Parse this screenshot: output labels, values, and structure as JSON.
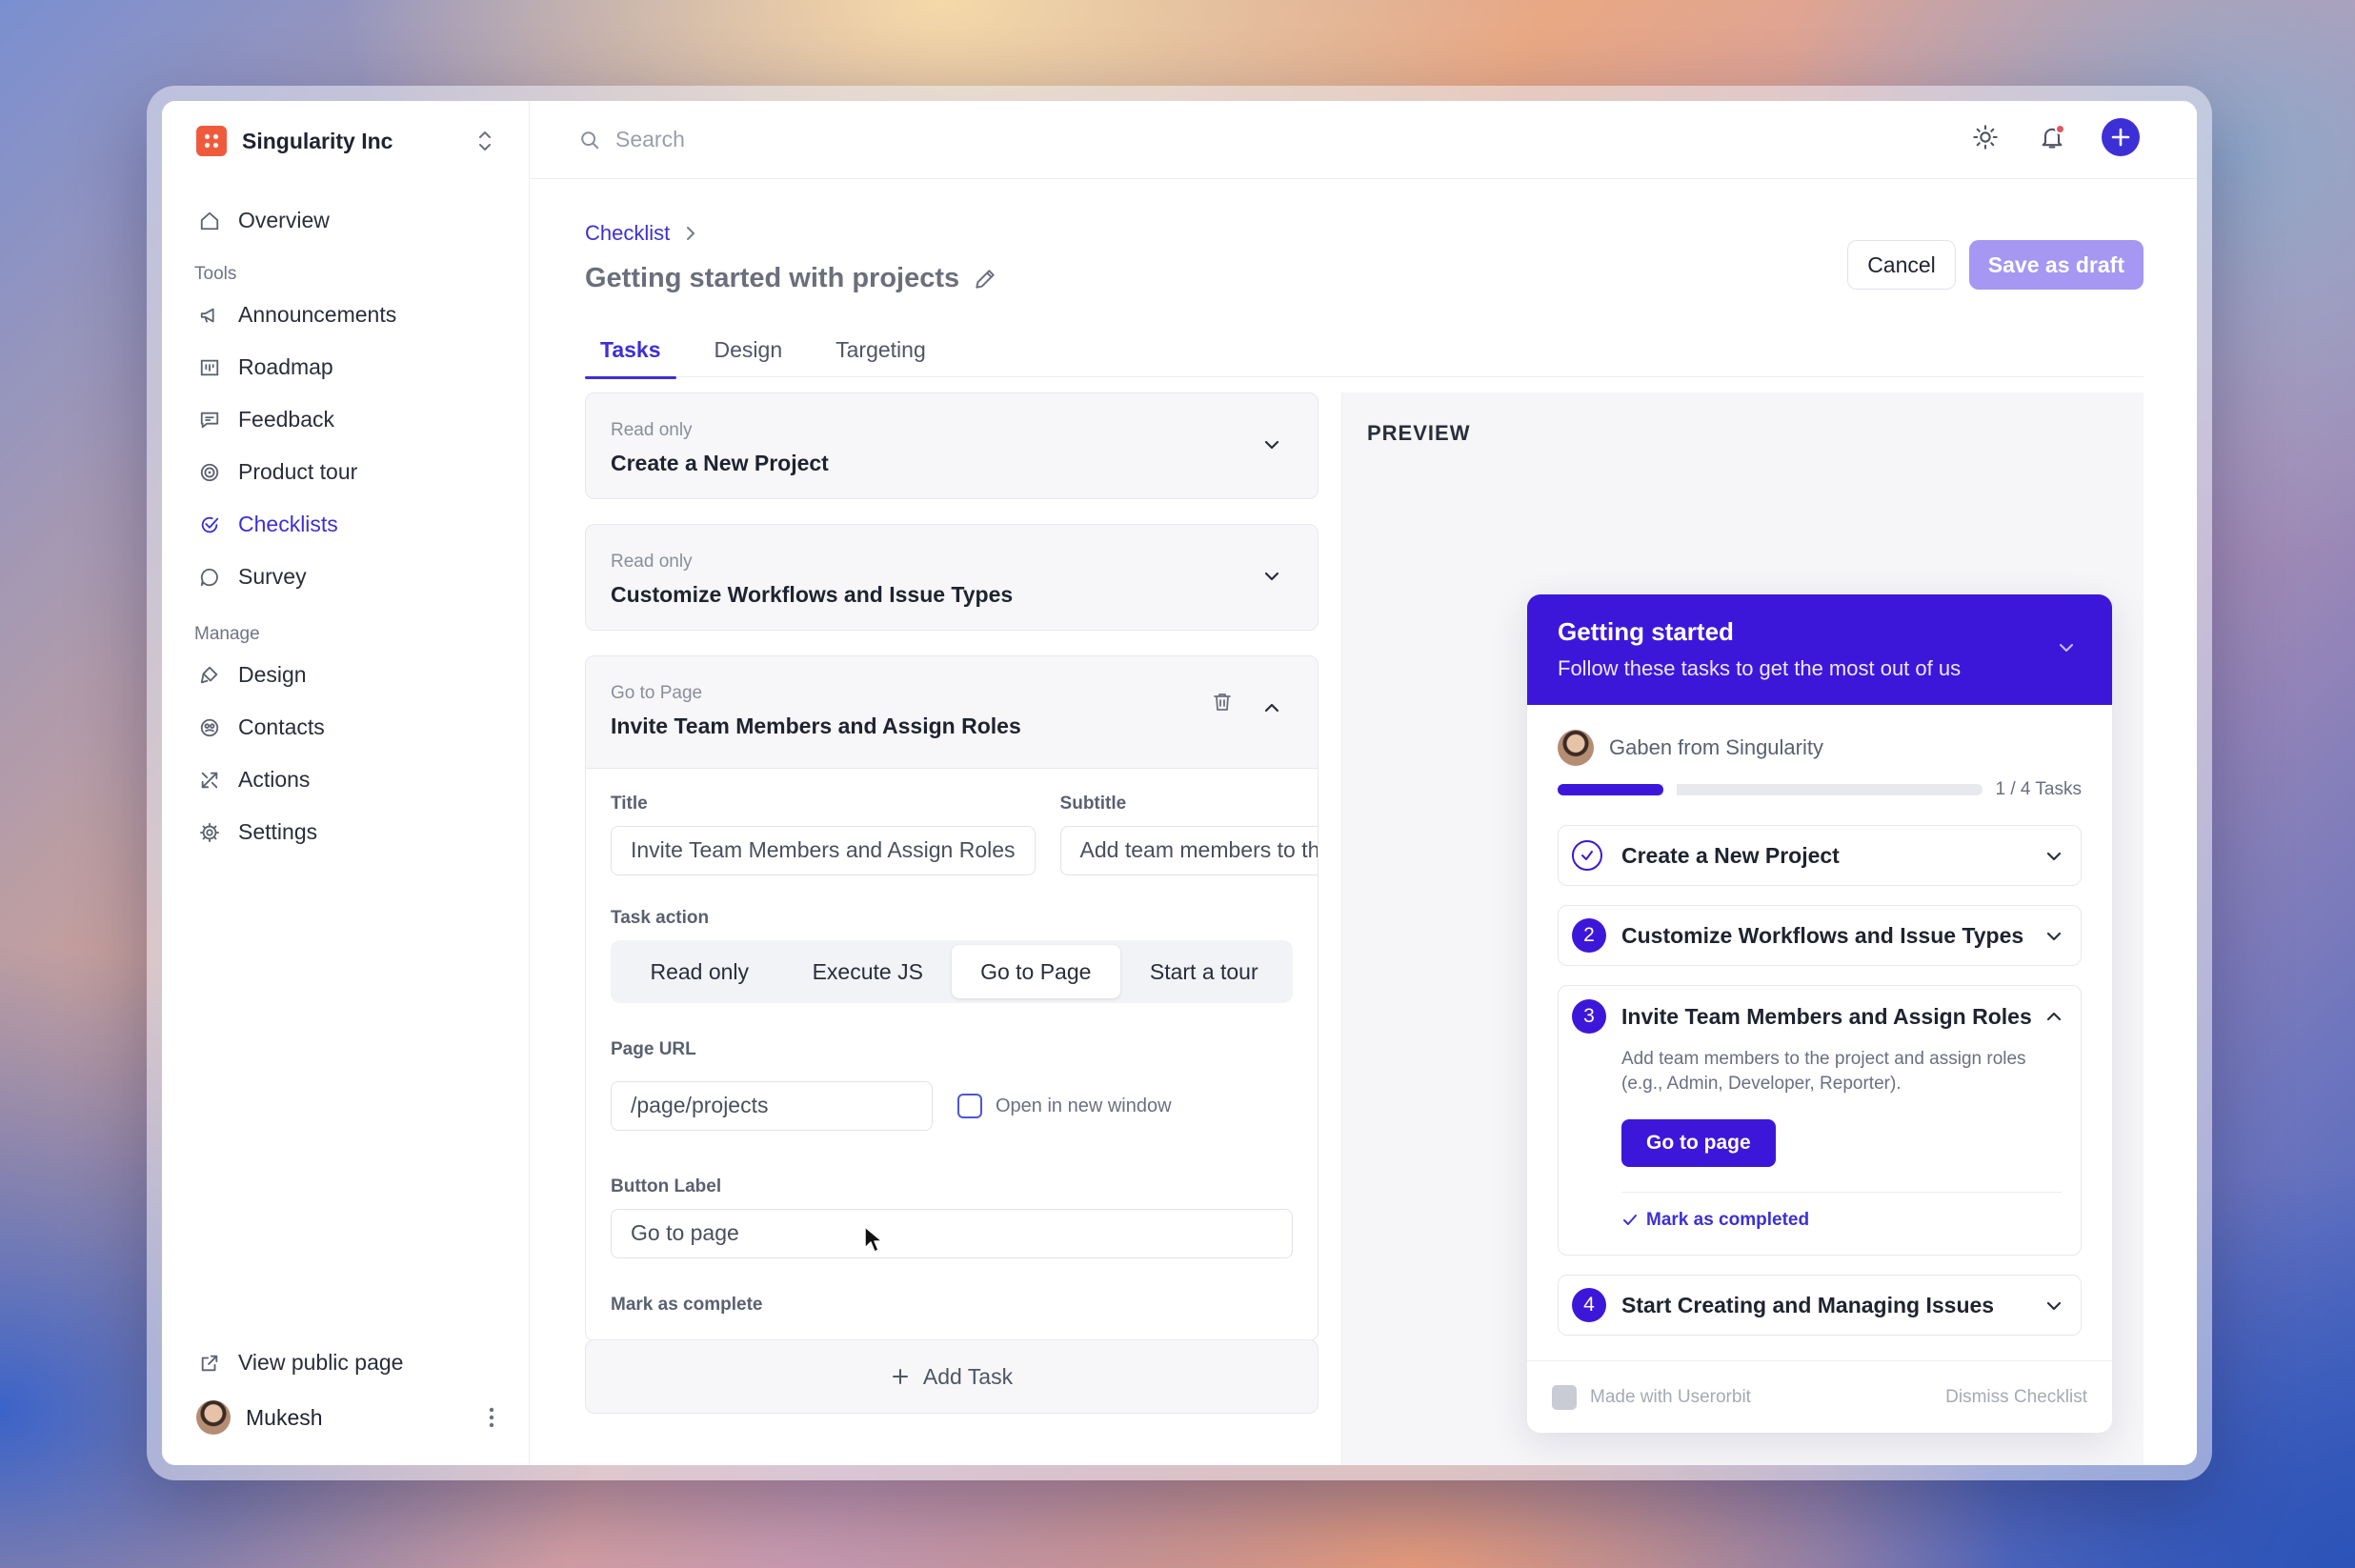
{
  "org": {
    "name": "Singularity Inc"
  },
  "sidebar": {
    "overview": "Overview",
    "tools_label": "Tools",
    "tools": [
      {
        "label": "Announcements",
        "icon": "megaphone-icon"
      },
      {
        "label": "Roadmap",
        "icon": "roadmap-icon"
      },
      {
        "label": "Feedback",
        "icon": "message-square-icon"
      },
      {
        "label": "Product tour",
        "icon": "target-icon"
      },
      {
        "label": "Checklists",
        "icon": "check-circle-icon",
        "active": true
      },
      {
        "label": "Survey",
        "icon": "chat-bubble-icon"
      }
    ],
    "manage_label": "Manage",
    "manage": [
      {
        "label": "Design",
        "icon": "paint-icon"
      },
      {
        "label": "Contacts",
        "icon": "contacts-icon"
      },
      {
        "label": "Actions",
        "icon": "actions-icon"
      },
      {
        "label": "Settings",
        "icon": "gear-icon"
      }
    ],
    "view_public": "View public page",
    "user": "Mukesh"
  },
  "topbar": {
    "search_placeholder": "Search"
  },
  "header": {
    "breadcrumb": "Checklist",
    "title": "Getting started with projects",
    "cancel": "Cancel",
    "save_draft": "Save as draft"
  },
  "tabs": [
    "Tasks",
    "Design",
    "Targeting"
  ],
  "tasks": [
    {
      "type": "Read only",
      "title": "Create a New Project"
    },
    {
      "type": "Read only",
      "title": "Customize Workflows and Issue Types"
    },
    {
      "type": "Go to Page",
      "title": "Invite Team Members and Assign Roles"
    }
  ],
  "form": {
    "title_label": "Title",
    "title_value": "Invite Team Members and Assign Roles",
    "subtitle_label": "Subtitle",
    "subtitle_value": "Add team members to the project",
    "task_action_label": "Task action",
    "actions": [
      "Read only",
      "Execute JS",
      "Go to Page",
      "Start a tour"
    ],
    "active_action": "Go to Page",
    "page_url_label": "Page URL",
    "page_url_value": "/page/projects",
    "open_new_window": "Open in new window",
    "button_label_label": "Button Label",
    "button_label_value": "Go to page",
    "mark_complete_label": "Mark as complete"
  },
  "add_task": "Add Task",
  "preview": {
    "label": "PREVIEW",
    "title": "Getting started",
    "subtitle": "Follow these tasks to get the most out of us",
    "author": "Gaben from Singularity",
    "progress_text": "1 / 4 Tasks",
    "progress_fraction": 0.25,
    "items": [
      {
        "num": "1",
        "title": "Create a New Project",
        "done": true
      },
      {
        "num": "2",
        "title": "Customize Workflows and Issue Types"
      },
      {
        "num": "3",
        "title": "Invite Team Members and Assign Roles",
        "expanded": true
      },
      {
        "num": "4",
        "title": "Start Creating and Managing Issues"
      }
    ],
    "expanded_desc": "Add team members to the project and assign roles (e.g., Admin, Developer, Reporter).",
    "go_button": "Go to page",
    "mark_completed": "Mark as completed",
    "made_with": "Made with Userorbit",
    "dismiss": "Dismiss Checklist"
  },
  "colors": {
    "accent": "#3d2fd6",
    "widget_brand": "#3d17d9",
    "draft_button": "#a597f2"
  }
}
